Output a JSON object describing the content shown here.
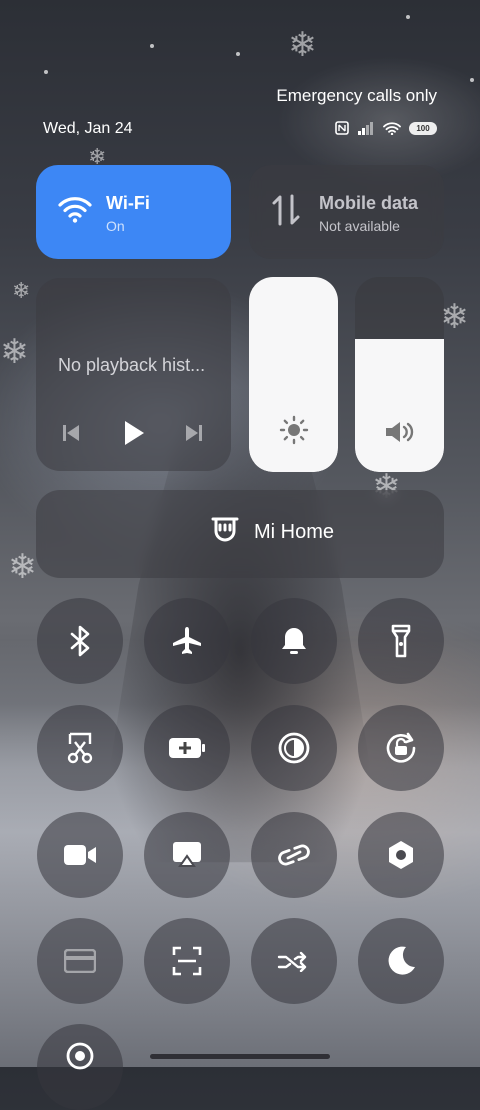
{
  "status": {
    "emergency": "Emergency calls only",
    "date": "Wed, Jan 24",
    "battery": "100"
  },
  "wifi": {
    "title": "Wi-Fi",
    "subtitle": "On"
  },
  "mobile": {
    "title": "Mobile data",
    "subtitle": "Not available"
  },
  "media": {
    "text": "No playback hist..."
  },
  "brightness": {
    "level": 1.0
  },
  "volume": {
    "level": 0.68
  },
  "mihome": {
    "label": "Mi Home"
  },
  "toggles": [
    {
      "name": "bluetooth",
      "active": true
    },
    {
      "name": "airplane-mode",
      "active": true
    },
    {
      "name": "sound",
      "active": true
    },
    {
      "name": "flashlight",
      "active": true
    },
    {
      "name": "screenshot",
      "active": true
    },
    {
      "name": "battery-saver",
      "active": true
    },
    {
      "name": "dark-mode",
      "active": true
    },
    {
      "name": "rotation-lock",
      "active": true
    },
    {
      "name": "screen-recorder",
      "active": true
    },
    {
      "name": "cast",
      "active": true
    },
    {
      "name": "link-sharing",
      "active": true
    },
    {
      "name": "settings",
      "active": true
    },
    {
      "name": "card",
      "active": false
    },
    {
      "name": "scanner",
      "active": true
    },
    {
      "name": "shuffle",
      "active": true
    },
    {
      "name": "do-not-disturb",
      "active": true
    },
    {
      "name": "location",
      "active": true
    }
  ]
}
